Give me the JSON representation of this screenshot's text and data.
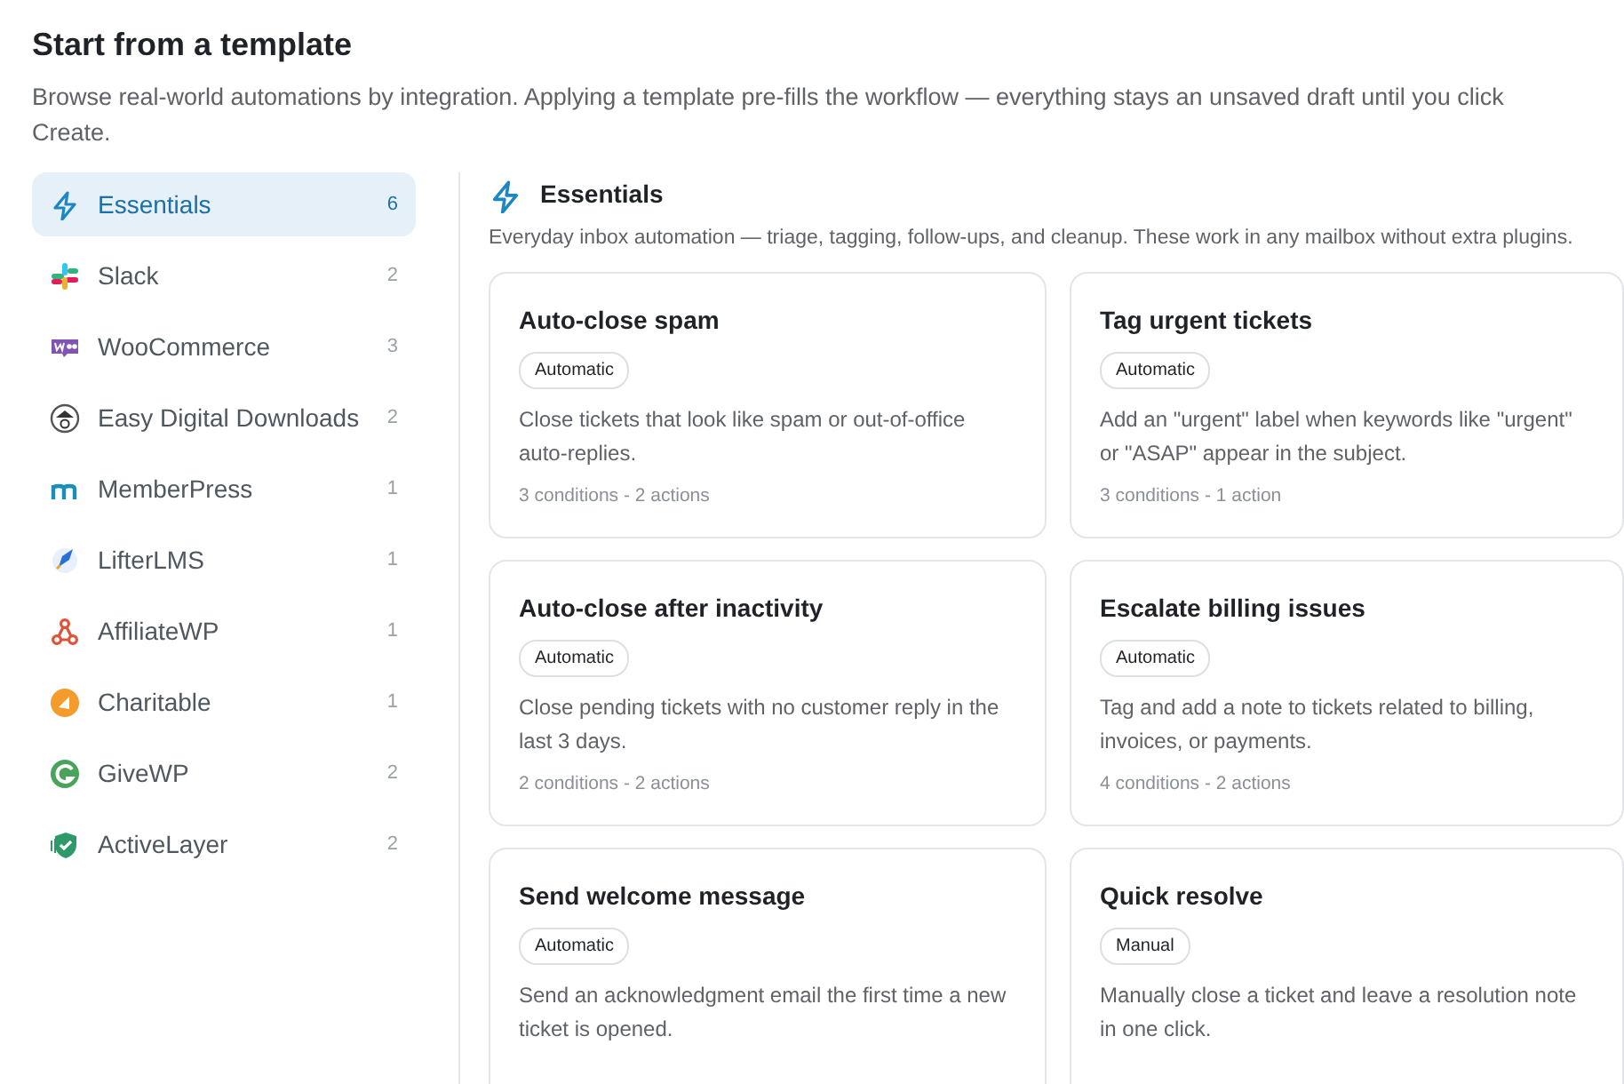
{
  "header": {
    "title": "Start from a template",
    "description": "Browse real-world automations by integration. Applying a template pre-fills the workflow — everything stays an unsaved draft until you click Create."
  },
  "sidebar": {
    "items": [
      {
        "label": "Essentials",
        "count": "6",
        "kind": "bolt",
        "selected": true
      },
      {
        "label": "Slack",
        "count": "2",
        "kind": "slack",
        "selected": false
      },
      {
        "label": "WooCommerce",
        "count": "3",
        "kind": "woo",
        "selected": false
      },
      {
        "label": "Easy Digital Downloads",
        "count": "2",
        "kind": "edd",
        "selected": false
      },
      {
        "label": "MemberPress",
        "count": "1",
        "kind": "memberpress",
        "selected": false
      },
      {
        "label": "LifterLMS",
        "count": "1",
        "kind": "lifter",
        "selected": false
      },
      {
        "label": "AffiliateWP",
        "count": "1",
        "kind": "affiliate",
        "selected": false
      },
      {
        "label": "Charitable",
        "count": "1",
        "kind": "charitable",
        "selected": false
      },
      {
        "label": "GiveWP",
        "count": "2",
        "kind": "give",
        "selected": false
      },
      {
        "label": "ActiveLayer",
        "count": "2",
        "kind": "shield",
        "selected": false
      }
    ]
  },
  "section": {
    "title": "Essentials",
    "description": "Everyday inbox automation — triage, tagging, follow-ups, and cleanup. These work in any mailbox without extra plugins."
  },
  "templates": [
    {
      "title": "Auto-close spam",
      "tag": "Automatic",
      "description": "Close tickets that look like spam or out-of-office auto-replies.",
      "summary": "3 conditions - 2 actions"
    },
    {
      "title": "Tag urgent tickets",
      "tag": "Automatic",
      "description": "Add an \"urgent\" label when keywords like \"urgent\" or \"ASAP\" appear in the subject.",
      "summary": "3 conditions - 1 action"
    },
    {
      "title": "Auto-close after inactivity",
      "tag": "Automatic",
      "description": "Close pending tickets with no customer reply in the last 3 days.",
      "summary": "2 conditions - 2 actions"
    },
    {
      "title": "Escalate billing issues",
      "tag": "Automatic",
      "description": "Tag and add a note to tickets related to billing, invoices, or payments.",
      "summary": "4 conditions - 2 actions"
    },
    {
      "title": "Send welcome message",
      "tag": "Automatic",
      "description": "Send an acknowledgment email the first time a new ticket is opened."
    },
    {
      "title": "Quick resolve",
      "tag": "Manual",
      "description": "Manually close a ticket and leave a resolution note in one click."
    }
  ]
}
